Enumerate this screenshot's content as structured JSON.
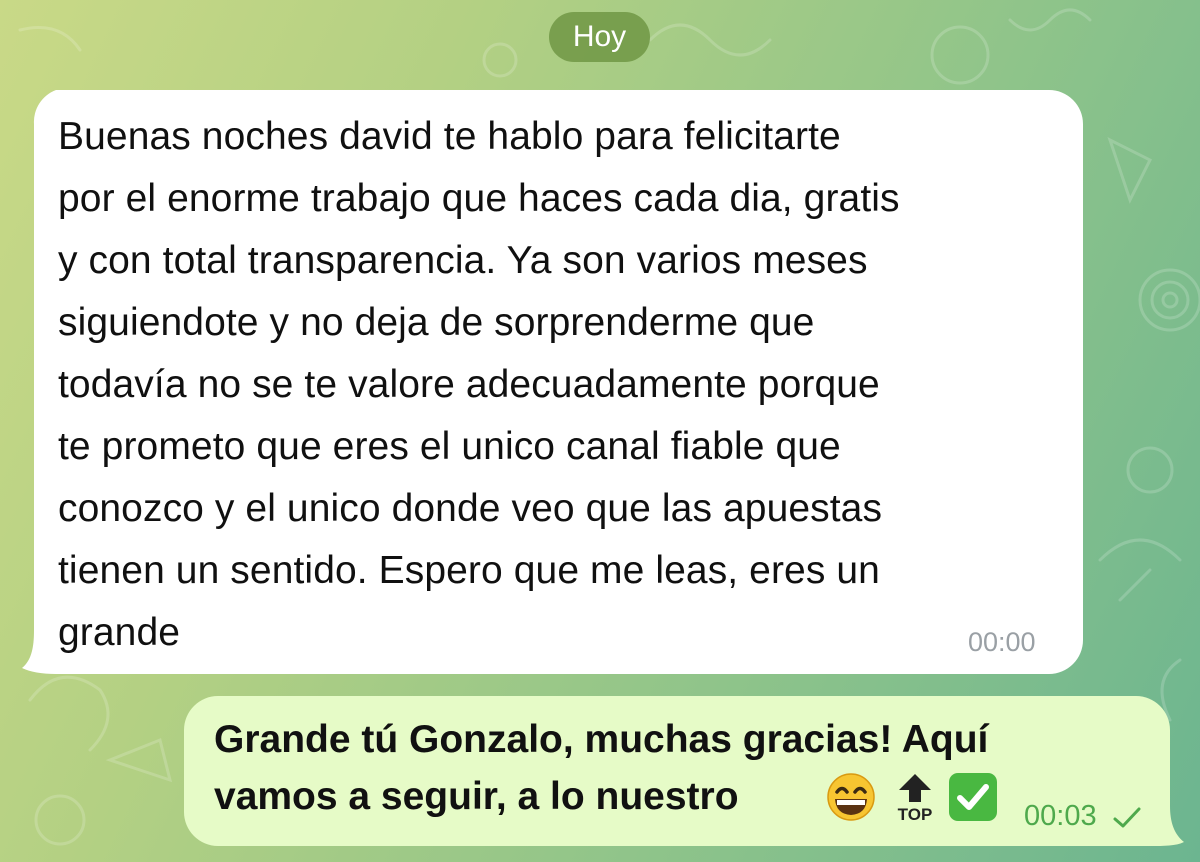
{
  "chat": {
    "date_separator": "Hoy",
    "incoming": {
      "text": "Buenas noches david te hablo para felicitarte\npor el enorme trabajo que haces cada dia, gratis\ny con total transparencia. Ya son varios meses\nsiguiendote y no deja de sorprenderme que\ntodavía no se te valore adecuadamente porque\nte prometo que eres el unico canal fiable que\nconozco y el unico donde veo que las apuestas\ntienen un sentido. Espero que me leas, eres un\ngrande",
      "time": "00:00"
    },
    "outgoing": {
      "text": "Grande tú Gonzalo, muchas gracias! Aquí\nvamos a seguir, a lo nuestro",
      "emojis": [
        "grinning-face-emoji",
        "top-arrow-emoji",
        "check-mark-button-emoji"
      ],
      "top_emoji_label": "TOP",
      "time": "00:03",
      "status": "sent-single-check"
    }
  },
  "colors": {
    "incoming_bubble": "#ffffff",
    "outgoing_bubble": "#e6fbc7",
    "date_chip": "#709644",
    "time_outgoing": "#4ea94c",
    "time_incoming": "#9aa0a5"
  }
}
